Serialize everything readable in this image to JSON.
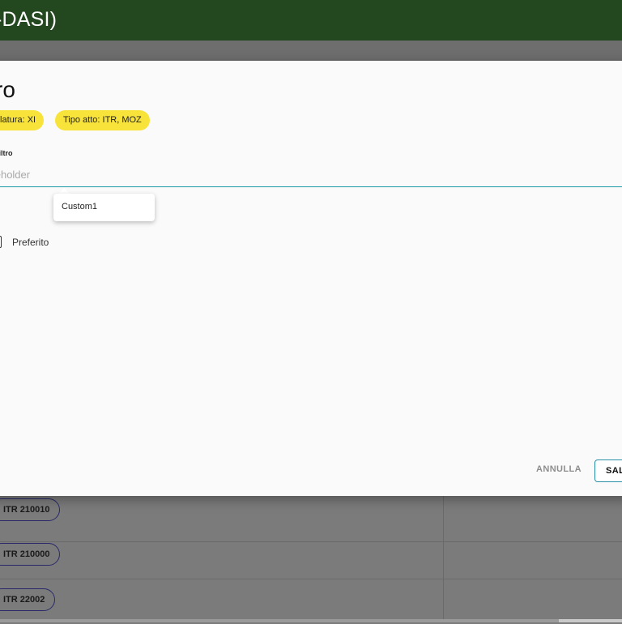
{
  "app": {
    "title": "-DASI)"
  },
  "dialog": {
    "title": "ltro",
    "chips": [
      "gislatura: XI",
      "Tipo atto: ITR, MOZ"
    ],
    "name_field": {
      "label": "me filtro",
      "value": "",
      "placeholder": "aceholder"
    },
    "suggestions": [
      "Custom1"
    ],
    "favorite_label": "Preferito",
    "favorite_checked": false,
    "buttons": {
      "cancel": "ANNULLA",
      "save": "SAL"
    }
  },
  "table": {
    "rows": [
      {
        "id": "ITR 210010"
      },
      {
        "id": "ITR 210000"
      },
      {
        "id": "ITR 22002"
      }
    ]
  },
  "colors": {
    "header": "#23471f",
    "chip": "#f8e33a",
    "accent": "#1a9aa8"
  }
}
